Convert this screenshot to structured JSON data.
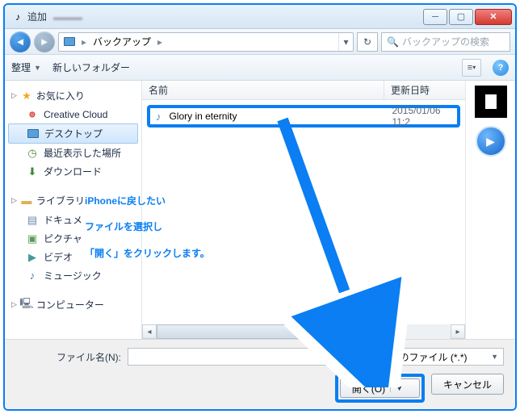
{
  "titlebar": {
    "icon": "♪",
    "title": "追加"
  },
  "nav": {
    "breadcrumb_icon_label": "PC",
    "breadcrumb_folder": "バックアップ",
    "refresh_aria": "refresh",
    "search_placeholder": "バックアップの検索"
  },
  "toolbar": {
    "organize": "整理",
    "new_folder": "新しいフォルダー"
  },
  "sidebar": {
    "favorites": {
      "label": "お気に入り"
    },
    "fav_items": [
      {
        "label": "Creative Cloud",
        "icon": "cc"
      },
      {
        "label": "デスクトップ",
        "icon": "monitor",
        "selected": true
      },
      {
        "label": "最近表示した場所",
        "icon": "clock",
        "truncated": true
      },
      {
        "label": "ダウンロード",
        "icon": "dl"
      }
    ],
    "libraries": {
      "label": "ライブラリ"
    },
    "lib_items": [
      {
        "label": "ドキュメ",
        "icon": "doc"
      },
      {
        "label": "ピクチャ",
        "icon": "pic"
      },
      {
        "label": "ビデオ",
        "icon": "vid"
      },
      {
        "label": "ミュージック",
        "icon": "music"
      }
    ],
    "computer": {
      "label": "コンピューター"
    }
  },
  "filelist": {
    "columns": {
      "name": "名前",
      "date": "更新日時"
    },
    "rows": [
      {
        "name": "Glory in eternity",
        "date": "2015/01/06 11:2"
      }
    ]
  },
  "footer": {
    "filename_label": "ファイル名(N):",
    "filename_value": "",
    "filter": "べてのファイル (*.*)",
    "open": "開く(O)",
    "cancel": "キャンセル"
  },
  "annotation": {
    "line1": "iPhoneに戻したい",
    "line2": "ファイルを選択し",
    "line3": "「開く」をクリックします。"
  }
}
